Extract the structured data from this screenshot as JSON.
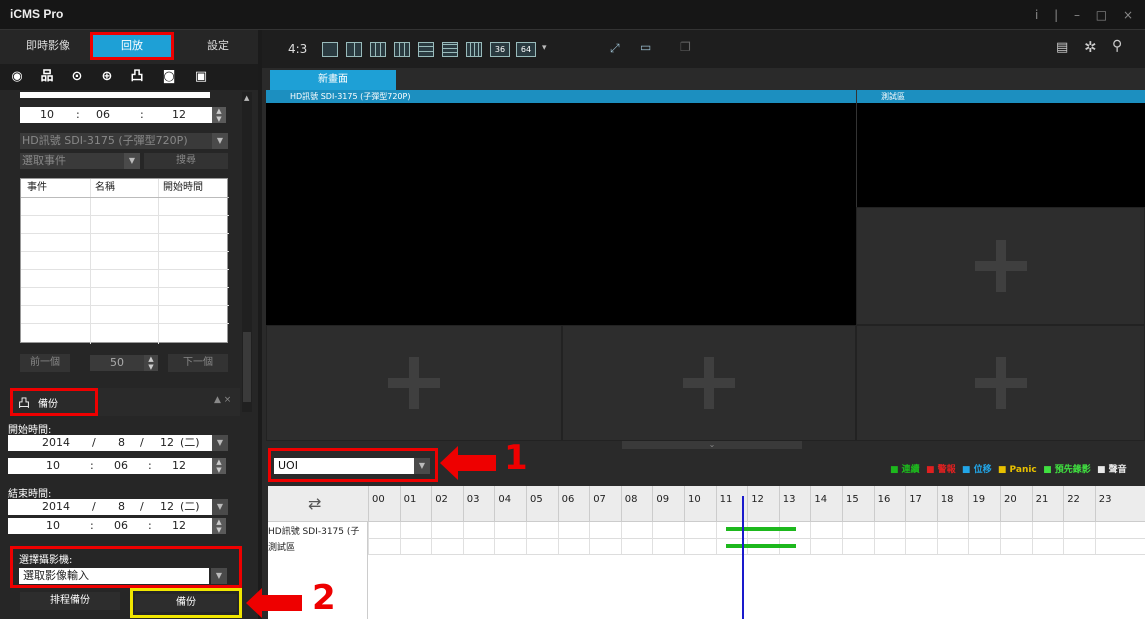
{
  "app": {
    "title": "iCMS Pro",
    "window_controls": "i | – □ ×"
  },
  "tabs": [
    {
      "label": "即時影像"
    },
    {
      "label": "回放"
    },
    {
      "label": "設定"
    }
  ],
  "search": {
    "time_hour": "10",
    "time_min": "06",
    "time_sec": "12",
    "camera": "HD訊號  SDI-3175 (子彈型720P)",
    "event_select": "選取事件",
    "search_btn": "搜尋",
    "columns": [
      "事件",
      "名稱",
      "開始時間"
    ],
    "prev": "前一個",
    "page": "50",
    "next": "下一個"
  },
  "backup": {
    "title": "備份",
    "start_label": "開始時間:",
    "start_year": "2014",
    "start_month": "8",
    "start_day": "12",
    "start_wd": "(二)",
    "start_h": "10",
    "start_m": "06",
    "start_s": "12",
    "end_label": "結束時間:",
    "end_year": "2014",
    "end_month": "8",
    "end_day": "12",
    "end_wd": "(二)",
    "end_h": "10",
    "end_m": "06",
    "end_s": "12",
    "camera_label": "選擇攝影機:",
    "camera_value": "選取影像輸入",
    "schedule_btn": "排程備份",
    "backup_btn": "備份"
  },
  "layout": {
    "ratio": "4:3",
    "n36": "36",
    "n64": "64"
  },
  "view": {
    "tab": "新畫面",
    "ch1": "HD訊號  SDI-3175 (子彈型720P)",
    "ch2": "測試區"
  },
  "playback": {
    "dropdown": "UOI",
    "legend": [
      {
        "label": "連續",
        "color": "#1db81d"
      },
      {
        "label": "警報",
        "color": "#e02020"
      },
      {
        "label": "位移",
        "color": "#22a6e8"
      },
      {
        "label": "Panic",
        "color": "#e8c000"
      },
      {
        "label": "預先錄影",
        "color": "#40e040"
      },
      {
        "label": "聲音",
        "color": "#e8e8e8"
      }
    ],
    "hours": [
      "00",
      "01",
      "02",
      "03",
      "04",
      "05",
      "06",
      "07",
      "08",
      "09",
      "10",
      "11",
      "12",
      "13",
      "14",
      "15",
      "16",
      "17",
      "18",
      "19",
      "20",
      "21",
      "22",
      "23"
    ],
    "rows": [
      "HD訊號  SDI-3175 (子",
      "測試區"
    ]
  },
  "annotations": {
    "one": "1",
    "two": "2"
  }
}
